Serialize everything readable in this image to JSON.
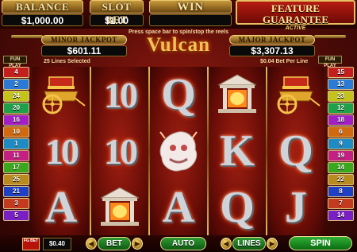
{
  "header": {
    "balance_label": "BALANCE",
    "balance_value": "$1,000.00",
    "slot_bet_label": "SLOT BET",
    "slot_bet_value": "$1.00",
    "win_label": "WIN",
    "win_value": "",
    "feature_title": "FEATURE GUARANTEE",
    "feature_sub": "ACTIVE"
  },
  "hint": "Press space bar to spin/stop the reels",
  "jackpots": {
    "minor_label": "MINOR JACKPOT",
    "minor_value": "$601.11",
    "major_label": "MAJOR JACKPOT",
    "major_value": "$3,307.13"
  },
  "logo": "Vulcan",
  "fun_play": "FUN PLAY",
  "lines_selected": "25 Lines Selected",
  "bet_per_line": "$0.04 Bet Per Line",
  "left_lines": [
    "4",
    "2",
    "24",
    "20",
    "16",
    "10",
    "1",
    "11",
    "17",
    "25",
    "21",
    "3",
    "5"
  ],
  "right_lines": [
    "15",
    "13",
    "23",
    "12",
    "18",
    "6",
    "9",
    "19",
    "14",
    "22",
    "8",
    "7",
    "14"
  ],
  "line_colors": [
    "#c41f1f",
    "#2b7bd6",
    "#c3c31c",
    "#1fa04a",
    "#a21fc4",
    "#d06a12",
    "#1f8bc4",
    "#c41f82",
    "#3aa81f",
    "#b88a1f",
    "#1f3fc4",
    "#c43a1f",
    "#7a1fc4"
  ],
  "reels": [
    [
      "chariot",
      "10",
      "A"
    ],
    [
      "10",
      "10",
      "temple"
    ],
    [
      "Q",
      "vulcan-bonus",
      "A"
    ],
    [
      "temple",
      "K",
      "Q"
    ],
    [
      "chariot",
      "Q",
      "J"
    ]
  ],
  "bottom": {
    "fg_bet": "FG BET",
    "fg_value": "$0.40",
    "bet_label": "BET",
    "autoplay_label": "AUTO PLAY",
    "lines_label": "LINES",
    "spin_label": "SPIN"
  }
}
